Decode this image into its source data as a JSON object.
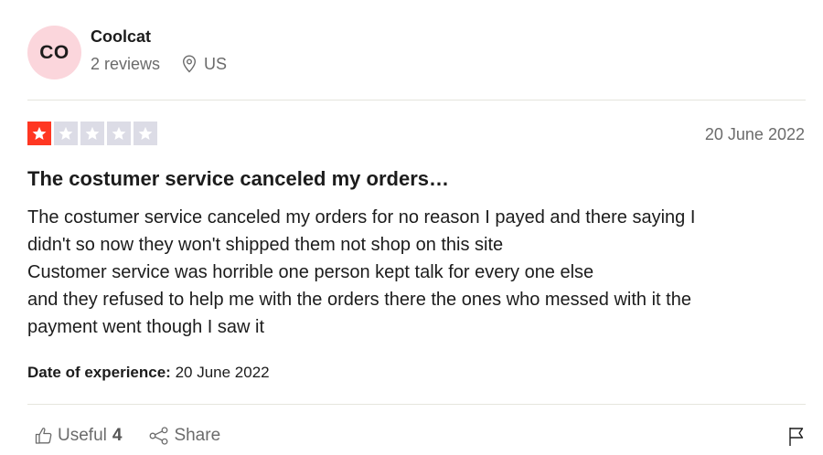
{
  "consumer": {
    "avatar_initials": "CO",
    "name": "Coolcat",
    "reviews_count": "2 reviews",
    "location": "US",
    "avatar_color": "#fbd6dc"
  },
  "review": {
    "rating": 1,
    "max_rating": 5,
    "star_color": "#ff3722",
    "date": "20 June 2022",
    "title": "The costumer service canceled my orders…",
    "body_lines": [
      "The costumer service canceled my orders for no reason I payed and there saying I",
      "didn't so now they won't shipped them not shop on this site",
      "Customer service was horrible one person kept talk for every one else",
      "and they refused to help me with the orders there the ones who messed with it the",
      "payment went though I saw it"
    ],
    "experience_label": "Date of experience:",
    "experience_date": "20 June 2022"
  },
  "actions": {
    "useful_label": "Useful",
    "useful_count": "4",
    "share_label": "Share",
    "icons": [
      "thumbs-up-icon",
      "share-icon",
      "flag-icon",
      "location-pin-icon",
      "star-icon"
    ]
  }
}
